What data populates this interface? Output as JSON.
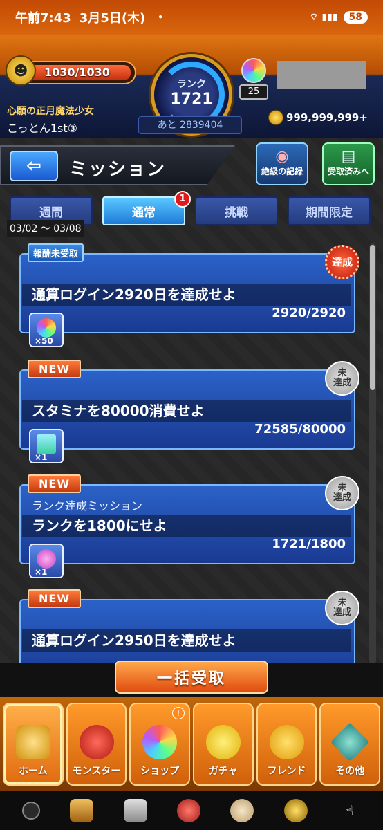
{
  "status": {
    "time": "午前7:43",
    "date": "3月5日(木)",
    "dot": "•",
    "signal": "⌔ ▮▮▮",
    "battery": "58"
  },
  "header": {
    "stamina": "1030/1030",
    "rank_label": "ランク",
    "rank_value": "1721",
    "rank_next": "あと 2839404",
    "orb_count": "25",
    "title": "心願の正月魔法少女",
    "player_name": "こっとん1st③",
    "coins": "999,999,999+"
  },
  "page": {
    "back_label": "⇦",
    "title": "ミッション",
    "icon_record": "絶級の記録",
    "icon_received": "受取済みへ",
    "date_range": "03/02 ～ 03/08"
  },
  "tabs": [
    {
      "label": "週間"
    },
    {
      "label": "通常",
      "badge": "1"
    },
    {
      "label": "挑戦"
    },
    {
      "label": "期間限定"
    }
  ],
  "missions": [
    {
      "tag": "報酬未受取",
      "subtitle": "",
      "name": "通算ログイン2920日を達成せよ",
      "progress": "2920/2920",
      "reward_qty": "×50",
      "stamp": "達成"
    },
    {
      "tag": "NEW",
      "subtitle": "",
      "name": "スタミナを80000消費せよ",
      "progress": "72585/80000",
      "reward_qty": "×1",
      "stamp": "未\n達成"
    },
    {
      "tag": "NEW",
      "subtitle": "ランク達成ミッション",
      "name": "ランクを1800にせよ",
      "progress": "1721/1800",
      "reward_qty": "×1",
      "stamp": "未\n達成"
    },
    {
      "tag": "NEW",
      "subtitle": "",
      "name": "通算ログイン2950日を達成せよ",
      "progress": "",
      "reward_qty": "",
      "stamp": "未\n達成"
    }
  ],
  "collect_all": "一括受取",
  "nav": [
    {
      "label": "ホーム"
    },
    {
      "label": "モンスター"
    },
    {
      "label": "ショップ",
      "alert": "!"
    },
    {
      "label": "ガチャ"
    },
    {
      "label": "フレンド"
    },
    {
      "label": "その他"
    }
  ]
}
